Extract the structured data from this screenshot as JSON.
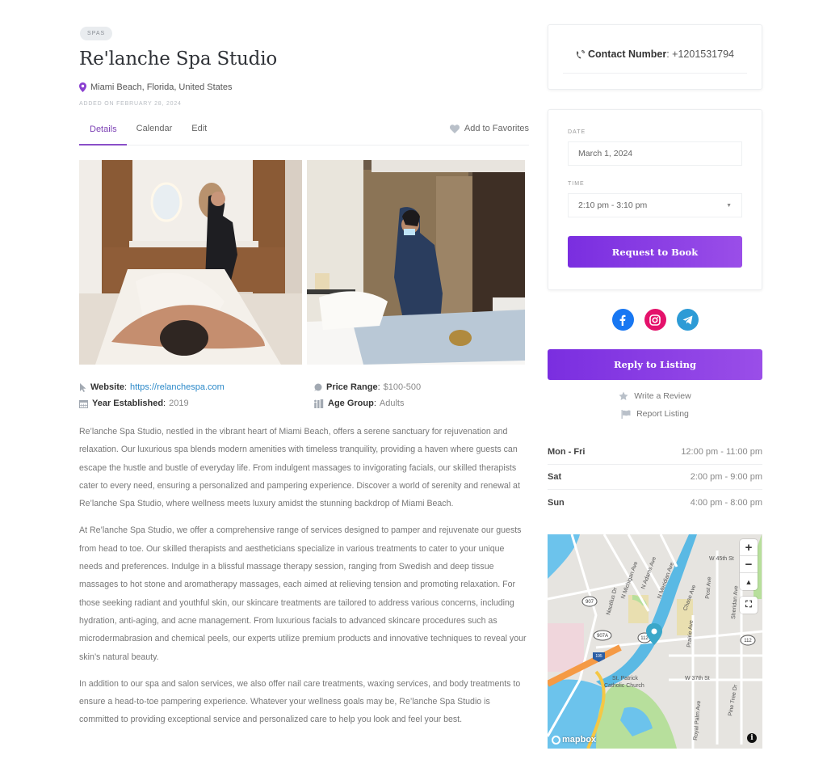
{
  "listing": {
    "category": "SPAS",
    "title": "Re'lanche Spa Studio",
    "location": "Miami Beach, Florida, United States",
    "added": "ADDED ON FEBRUARY 28, 2024"
  },
  "tabs": [
    {
      "label": "Details",
      "active": true
    },
    {
      "label": "Calendar",
      "active": false
    },
    {
      "label": "Edit",
      "active": false
    }
  ],
  "favorite_label": "Add to Favorites",
  "meta": {
    "website_label": "Website",
    "website_value": "https://relanchespa.com",
    "price_label": "Price Range",
    "price_value": "$100-500",
    "year_label": "Year Established",
    "year_value": "2019",
    "age_label": "Age Group",
    "age_value": "Adults"
  },
  "description": [
    "Re’lanche Spa Studio, nestled in the vibrant heart of Miami Beach, offers a serene sanctuary for rejuvenation and relaxation. Our luxurious spa blends modern amenities with timeless tranquility, providing a haven where guests can escape the hustle and bustle of everyday life. From indulgent massages to invigorating facials, our skilled therapists cater to every need, ensuring a personalized and pampering experience. Discover a world of serenity and renewal at Re’lanche Spa Studio, where wellness meets luxury amidst the stunning backdrop of Miami Beach.",
    "At Re’lanche Spa Studio, we offer a comprehensive range of services designed to pamper and rejuvenate our guests from head to toe. Our skilled therapists and aestheticians specialize in various treatments to cater to your unique needs and preferences. Indulge in a blissful massage therapy session, ranging from Swedish and deep tissue massages to hot stone and aromatherapy massages, each aimed at relieving tension and promoting relaxation. For those seeking radiant and youthful skin, our skincare treatments are tailored to address various concerns, including hydration, anti-aging, and acne management. From luxurious facials to advanced skincare procedures such as microdermabrasion and chemical peels, our experts utilize premium products and innovative techniques to reveal your skin’s natural beauty.",
    "In addition to our spa and salon services, we also offer nail care treatments, waxing services, and body treatments to ensure a head-to-toe pampering experience. Whatever your wellness goals may be, Re’lanche Spa Studio is committed to providing exceptional service and personalized care to help you look and feel your best."
  ],
  "contact": {
    "label": "Contact Number",
    "value": "+1201531794"
  },
  "booking": {
    "date_label": "DATE",
    "date_value": "March 1, 2024",
    "time_label": "TIME",
    "time_value": "2:10 pm - 3:10 pm",
    "button": "Request to Book"
  },
  "socials": [
    {
      "name": "facebook",
      "color": "#1877f2"
    },
    {
      "name": "instagram",
      "color": "#e4126b"
    },
    {
      "name": "telegram",
      "color": "#2d9bd6"
    }
  ],
  "reply_button": "Reply to Listing",
  "write_review": "Write a Review",
  "report_listing": "Report Listing",
  "hours": [
    {
      "day": "Mon - Fri",
      "time": "12:00 pm - 11:00 pm"
    },
    {
      "day": "Sat",
      "time": "2:00 pm - 9:00 pm"
    },
    {
      "day": "Sun",
      "time": "4:00 pm - 8:00 pm"
    }
  ],
  "map": {
    "labels": [
      "W 45th St",
      "N Adams Ave",
      "N Meridian Ave",
      "N Michigan Ave",
      "Nautilus Dr",
      "Chase Ave",
      "Post Ave",
      "Sheridan Ave",
      "Prairie Ave",
      "W 37th St",
      "St. Patrick Catholic Church",
      "Royal Palm Ave",
      "Pine Tree Dr"
    ],
    "shields": [
      "907",
      "907A",
      "112",
      "112",
      "195"
    ],
    "zoom_in": "+",
    "zoom_out": "−",
    "attribution": "mapbox",
    "info": "i"
  },
  "colors": {
    "accent": "#7a2ee0",
    "link": "#2a88c8",
    "pin": "#8a3fd0"
  }
}
